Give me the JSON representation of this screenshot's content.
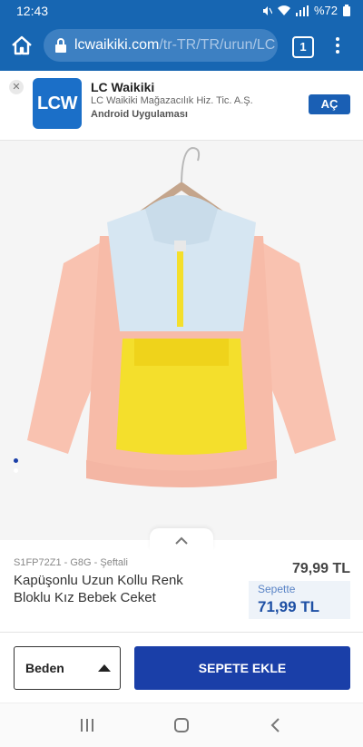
{
  "status_bar": {
    "time": "12:43",
    "battery": "%72"
  },
  "browser": {
    "url_host": "lcwaikiki.com",
    "url_path": "/tr-TR/TR/urun/LC",
    "tab_count": "1"
  },
  "app_banner": {
    "logo_text": "LCW",
    "name": "LC Waikiki",
    "company": "LC Waikiki Mağazacılık Hiz. Tic. A.Ş.",
    "type": "Android Uygulaması",
    "open_label": "AÇ"
  },
  "gallery": {
    "slide_count": 2,
    "active_slide": 1
  },
  "product": {
    "sku": "S1FP72Z1 - G8G - Şeftali",
    "title": "Kapüşonlu Uzun Kollu Renk Bloklu Kız Bebek Ceket",
    "price": "79,99 TL",
    "cart_label": "Sepette",
    "cart_price": "71,99 TL"
  },
  "actions": {
    "size_label": "Beden",
    "add_to_cart": "SEPETE EKLE"
  },
  "colors": {
    "brand_blue": "#1766b2",
    "button_blue": "#1a3fa8",
    "jacket_pink": "#f9c2b0",
    "jacket_blue": "#d6e6f2",
    "jacket_yellow": "#f4df2c"
  }
}
